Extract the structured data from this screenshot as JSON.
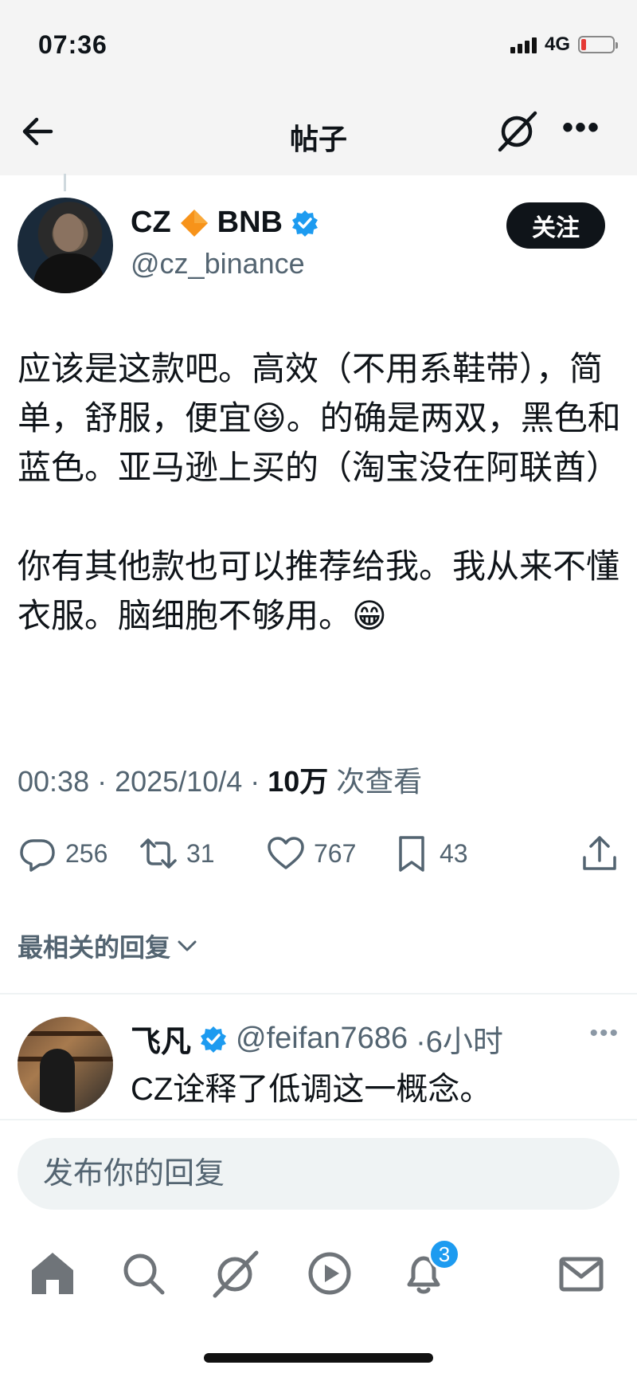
{
  "status_bar": {
    "time": "07:36",
    "network": "4G",
    "battery_level": 0.15
  },
  "nav": {
    "title": "帖子",
    "back_icon": "arrow-left-icon",
    "grok_icon": "grok-icon",
    "more_icon": "more-horizontal-icon",
    "more_label": "•••"
  },
  "post": {
    "author": {
      "name_prefix": "CZ",
      "name_suffix": "BNB",
      "handle": "@cz_binance",
      "verified": true
    },
    "follow_label": "关注",
    "paragraphs": [
      "应该是这款吧。高效（不用系鞋带），简单，舒服，便宜😆。的确是两双，黑色和蓝色。亚马逊上买的（淘宝没在阿联酋）",
      "你有其他款也可以推荐给我。我从来不懂衣服。脑细胞不够用。😁"
    ],
    "meta": {
      "time": "00:38",
      "date": "2025/10/4",
      "views": "10万",
      "views_suffix": "次查看",
      "separator": "·"
    },
    "actions": {
      "replies": "256",
      "reposts": "31",
      "likes": "767",
      "bookmarks": "43"
    }
  },
  "sort": {
    "label": "最相关的回复"
  },
  "reply": {
    "name": "飞凡",
    "handle": "@feifan7686",
    "time": "·6小时",
    "text": "CZ诠释了低调这一概念。",
    "more_label": "•••"
  },
  "compose": {
    "placeholder": "发布你的回复"
  },
  "tab_bar": {
    "notifications_count": "3",
    "items": [
      "home-icon",
      "search-icon",
      "grok-icon",
      "video-icon",
      "bell-icon",
      "mail-icon"
    ]
  },
  "colors": {
    "accent": "#1d9bf0",
    "text": "#0f1419",
    "muted": "#536471",
    "binance": "#f3ba2f"
  }
}
